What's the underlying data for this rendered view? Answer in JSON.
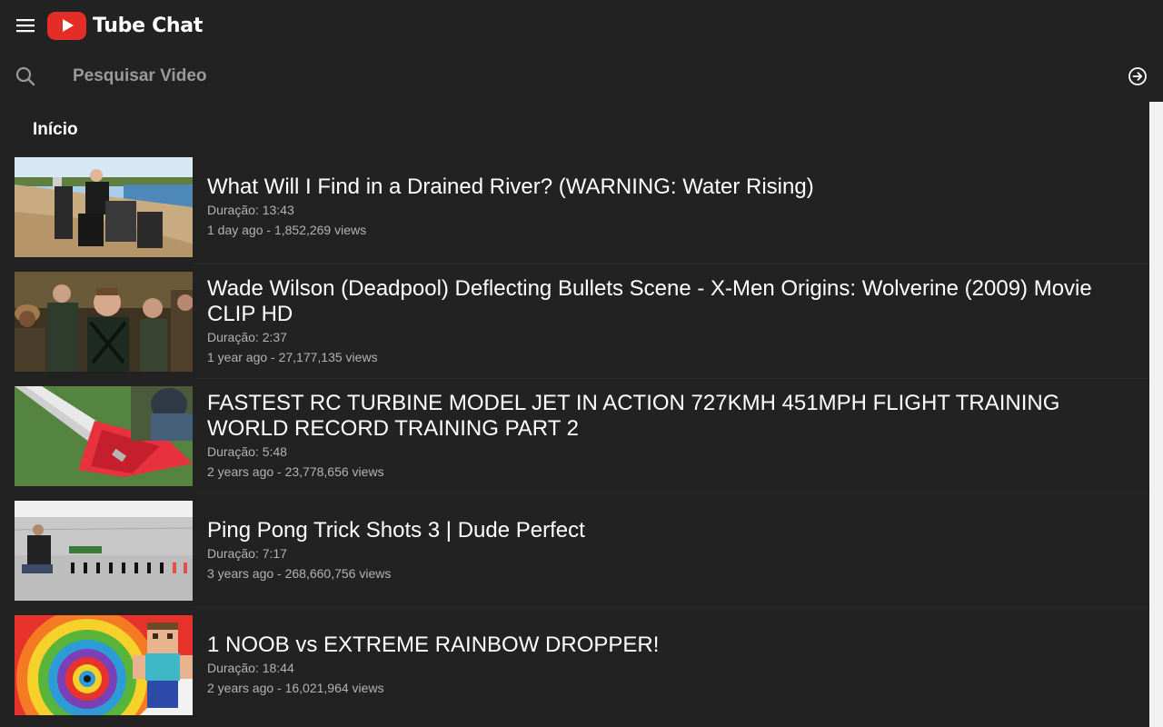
{
  "app": {
    "name": "Tube Chat",
    "brand_color": "#e52d27"
  },
  "header": {
    "menu_icon": "hamburger-menu-icon"
  },
  "search": {
    "placeholder": "Pesquisar Video",
    "value": "",
    "search_icon": "search-icon",
    "submit_icon": "arrow-circle-right-icon"
  },
  "section": {
    "title": "Início"
  },
  "videos": [
    {
      "title": "What Will I Find in a Drained River? (WARNING: Water Rising)",
      "duration": "Duração: 13:43",
      "meta": "1 day ago - 1,852,269 views"
    },
    {
      "title": "Wade Wilson (Deadpool) Deflecting Bullets Scene - X-Men Origins: Wolverine (2009) Movie CLIP HD",
      "duration": "Duração: 2:37",
      "meta": "1 year ago - 27,177,135 views"
    },
    {
      "title": "FASTEST RC TURBINE MODEL JET IN ACTION 727KMH 451MPH FLIGHT TRAINING WORLD RECORD TRAINING PART 2",
      "duration": "Duração: 5:48",
      "meta": "2 years ago - 23,778,656 views"
    },
    {
      "title": "Ping Pong Trick Shots 3 | Dude Perfect",
      "duration": "Duração: 7:17",
      "meta": "3 years ago - 268,660,756 views"
    },
    {
      "title": "1 NOOB vs EXTREME RAINBOW DROPPER!",
      "duration": "Duração: 18:44",
      "meta": "2 years ago - 16,021,964 views"
    }
  ]
}
